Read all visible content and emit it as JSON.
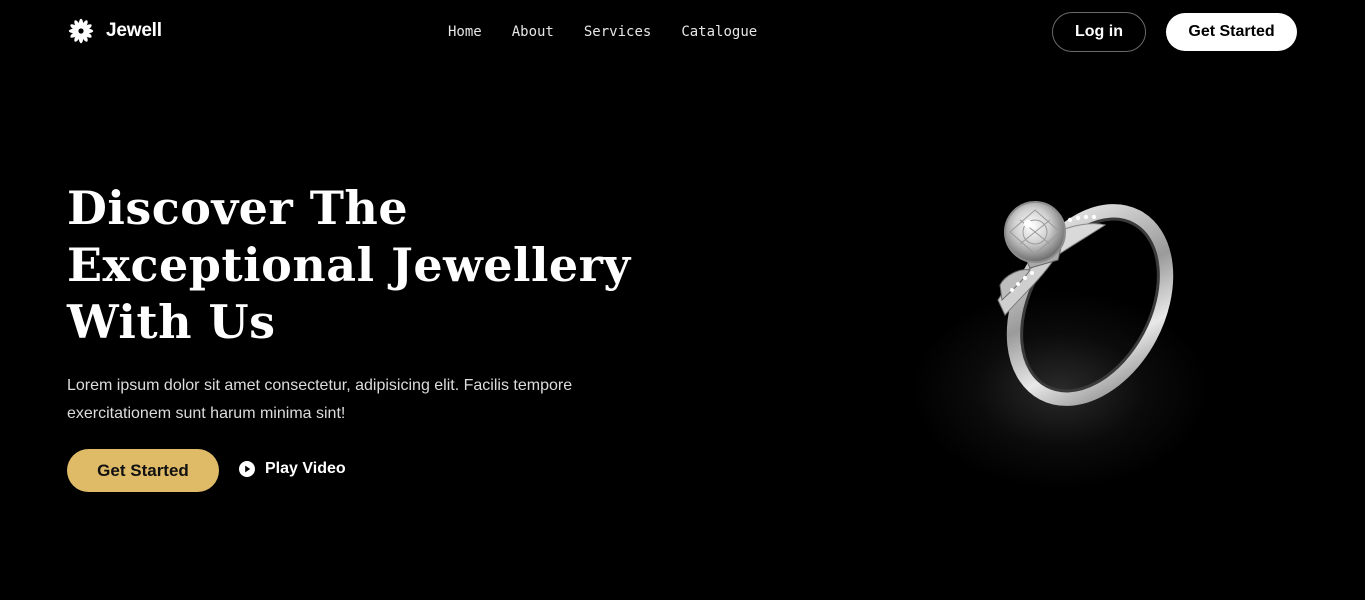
{
  "brand": {
    "name": "Jewell",
    "icon": "flower-logo-icon"
  },
  "nav": {
    "items": [
      {
        "label": "Home"
      },
      {
        "label": "About"
      },
      {
        "label": "Services"
      },
      {
        "label": "Catalogue"
      }
    ]
  },
  "header": {
    "login_label": "Log in",
    "get_started_label": "Get Started"
  },
  "hero": {
    "title_lines": [
      "Discover The",
      "Exceptional Jewellery",
      "With Us"
    ],
    "description": "Lorem ipsum dolor sit amet consectetur, adipisicing elit. Facilis tempore exercitationem sunt harum minima sint!",
    "cta_label": "Get Started",
    "play_label": "Play Video",
    "play_icon": "play-circle-icon",
    "image": "diamond-ring-image"
  },
  "colors": {
    "background": "#000000",
    "accent": "#dfbb68",
    "text": "#ffffff"
  }
}
